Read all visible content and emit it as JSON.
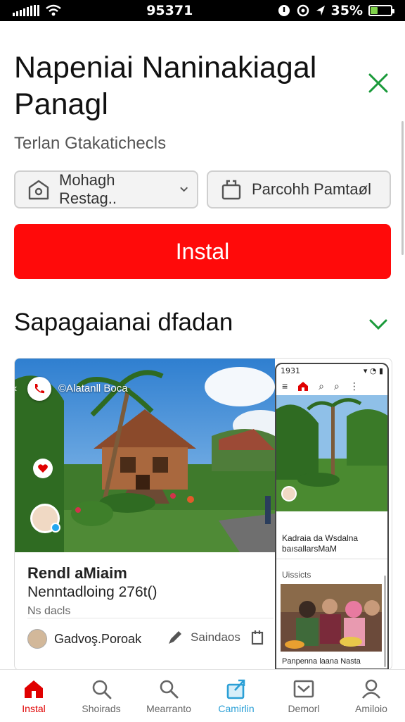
{
  "status_bar": {
    "time": "95371",
    "battery": "35%",
    "battery_level": 0.35
  },
  "header": {
    "title": "Napeniai Naninakiagal Panagl",
    "subtitle": "Terlan Gtakatichecls"
  },
  "chips": [
    {
      "label": "Mohagh Restag..",
      "icon": "store-icon",
      "has_dropdown": true
    },
    {
      "label": "Parcohh Pamtaøl",
      "icon": "bag-icon",
      "has_dropdown": false
    }
  ],
  "install_button": {
    "label": "Instal",
    "color": "#ff0a0a"
  },
  "section": {
    "title": "Sapagaianai dfadan"
  },
  "card": {
    "photo_caption": "©Alatanll Boca",
    "title": "Rendl aMiaim",
    "subtitle": "Nenntadloing 276t()",
    "meta": "Ns dacls",
    "author": "Gadvoş.Poroak",
    "saved": "Saindaos"
  },
  "phone_preview": {
    "time": "1931",
    "title": "Kadraia da Wsdalna baısallarsMaM",
    "section": "Uissicts",
    "caption": "Panpenna laana Nasta"
  },
  "bottom_nav": [
    {
      "label": "Instal",
      "icon": "home-icon",
      "state": "active-red"
    },
    {
      "label": "Shoirads",
      "icon": "search-icon",
      "state": ""
    },
    {
      "label": "Mearranto",
      "icon": "magnifier-icon",
      "state": ""
    },
    {
      "label": "Camirlin",
      "icon": "share-icon",
      "state": "active-blue"
    },
    {
      "label": "Demorl",
      "icon": "inbox-icon",
      "state": ""
    },
    {
      "label": "Amiloio",
      "icon": "profile-icon",
      "state": ""
    }
  ],
  "colors": {
    "accent_red": "#ff0a0a",
    "accent_green": "#1a9a3a",
    "accent_blue": "#2a9fd6"
  }
}
